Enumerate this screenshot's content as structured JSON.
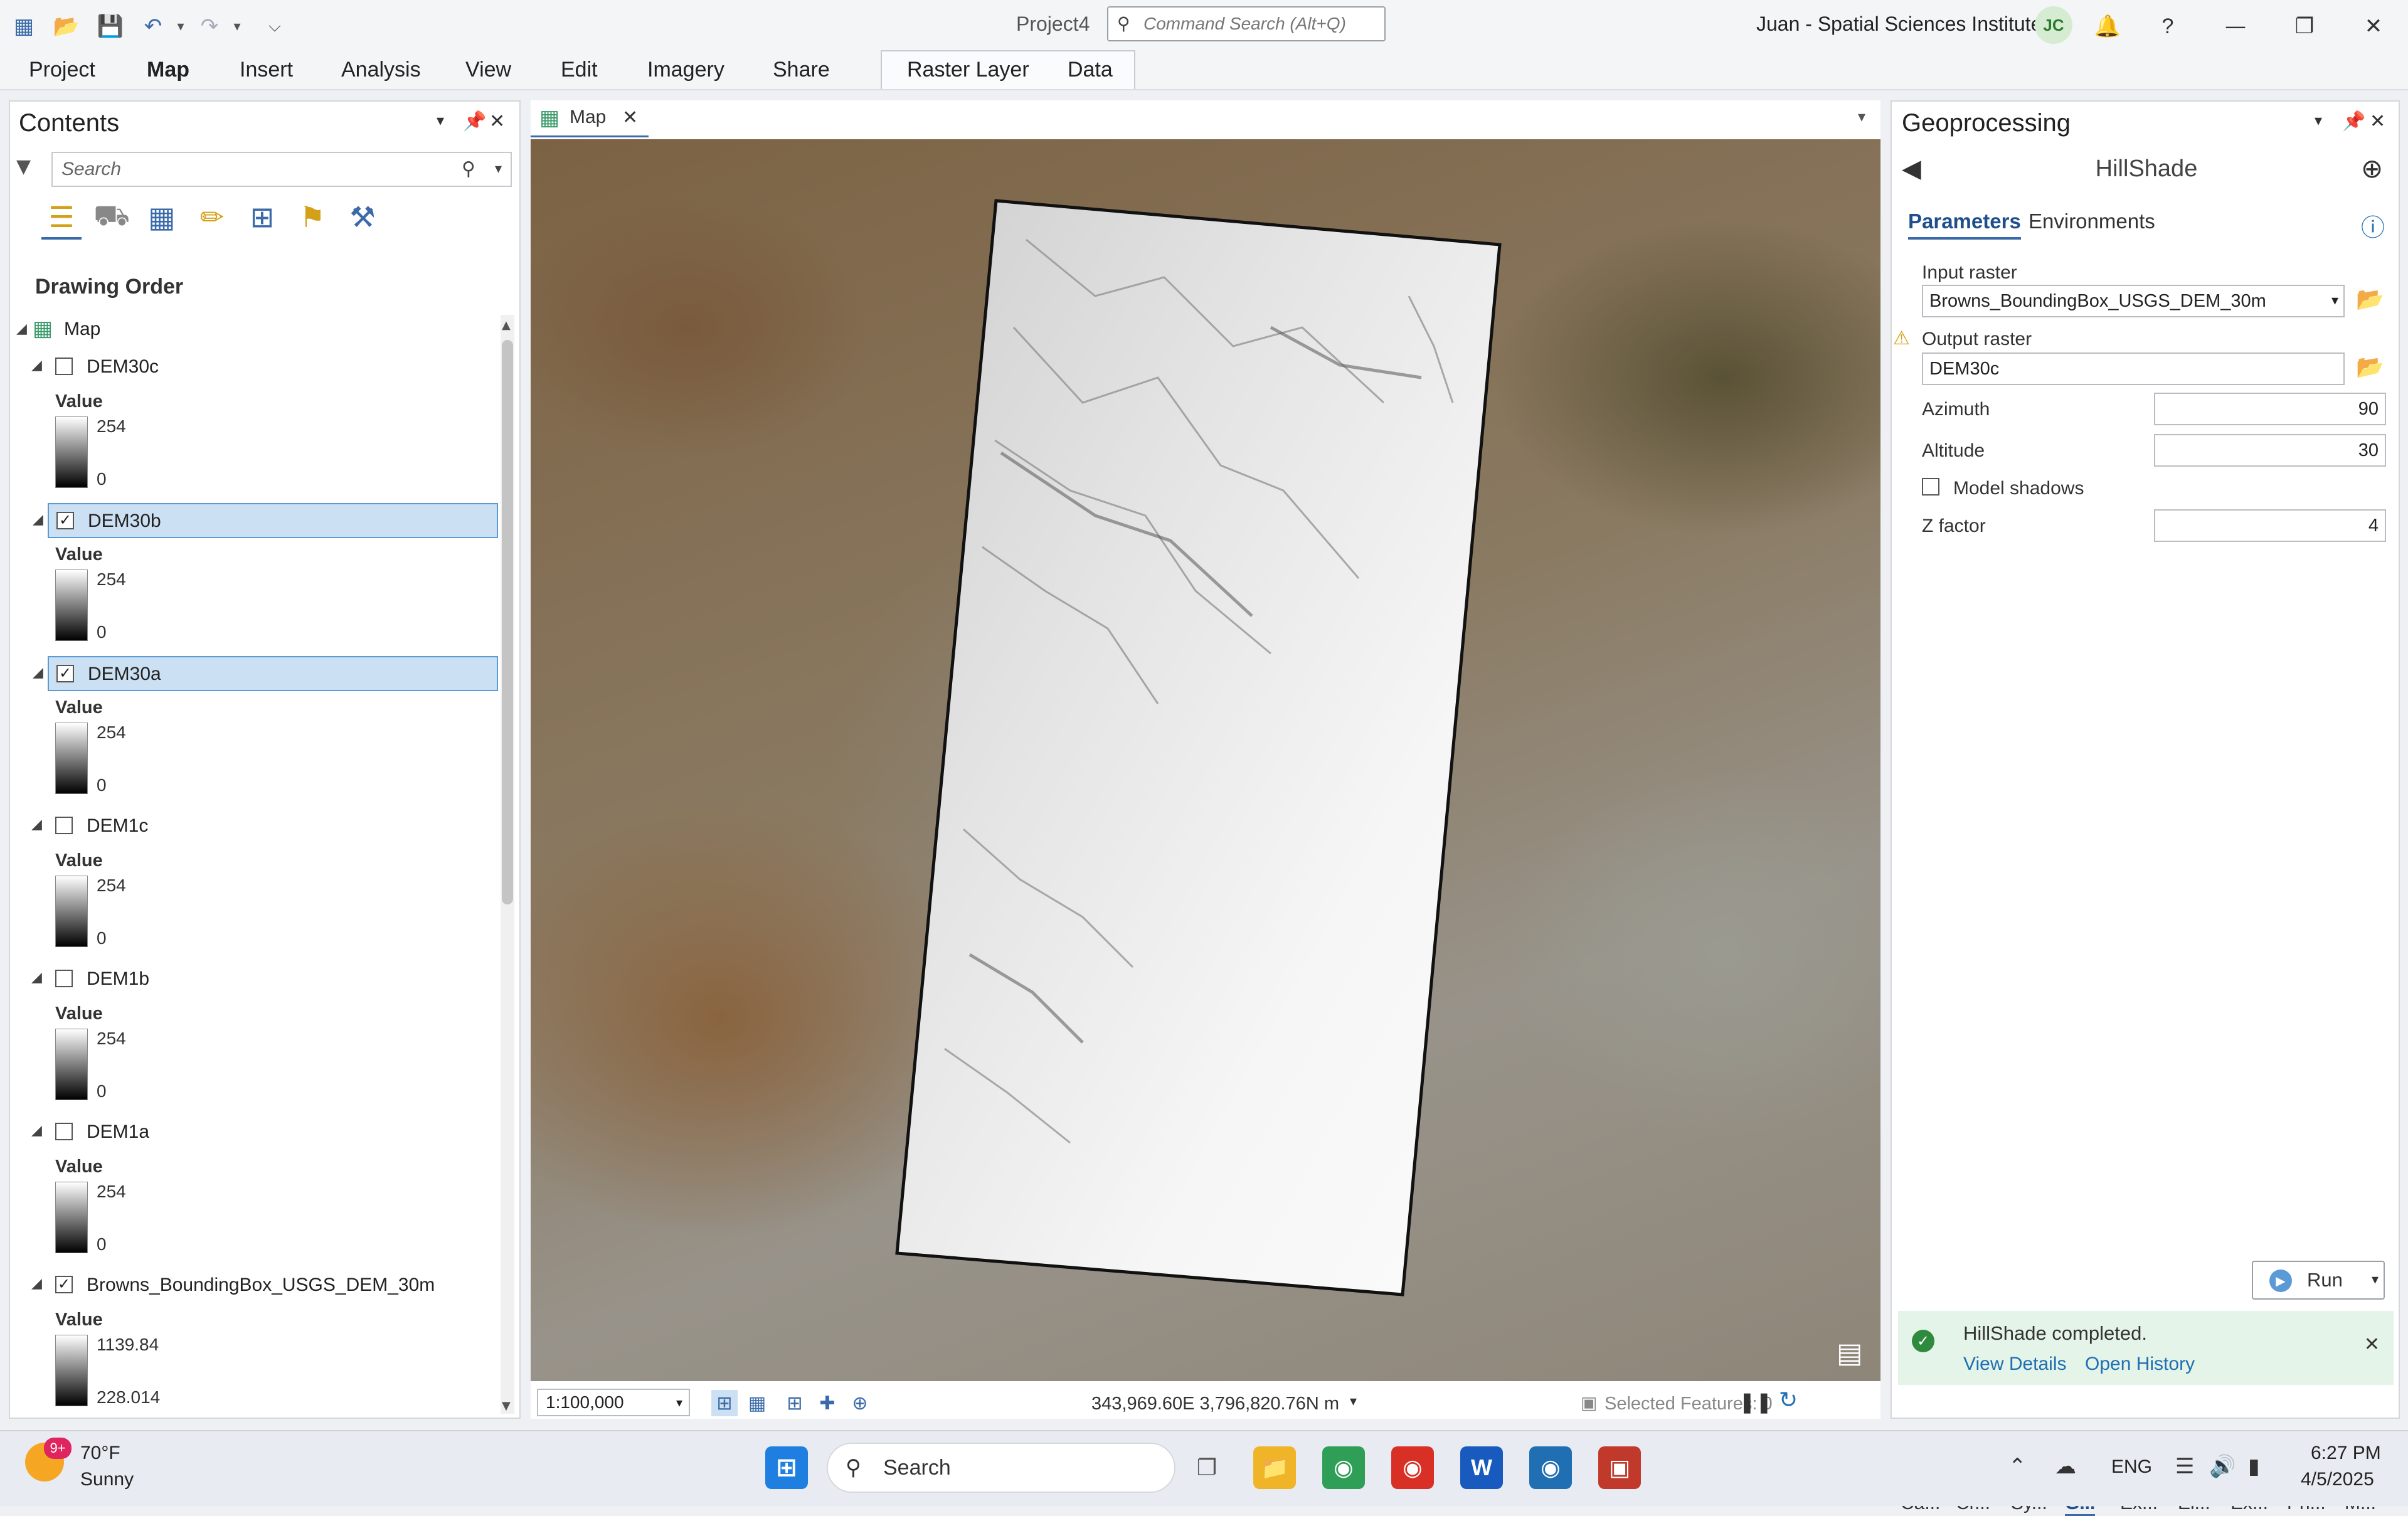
{
  "title_bar": {
    "app_title": "Project4",
    "command_search_placeholder": "Command Search (Alt+Q)",
    "user": "Juan - Spatial Sciences Institute",
    "avatar_initials": "JC"
  },
  "ribbon": {
    "tabs": [
      "Project",
      "Map",
      "Insert",
      "Analysis",
      "View",
      "Edit",
      "Imagery",
      "Share"
    ],
    "active_tab": "Map",
    "contextual_tabs": [
      "Raster Layer",
      "Data"
    ]
  },
  "contents": {
    "title": "Contents",
    "search_placeholder": "Search",
    "drawing_order_label": "Drawing Order",
    "map_label": "Map",
    "layers": [
      {
        "name": "DEM30c",
        "checked": false,
        "selected": false,
        "value_label": "Value",
        "max": "254",
        "min": "0"
      },
      {
        "name": "DEM30b",
        "checked": true,
        "selected": true,
        "value_label": "Value",
        "max": "254",
        "min": "0"
      },
      {
        "name": "DEM30a",
        "checked": true,
        "selected": true,
        "value_label": "Value",
        "max": "254",
        "min": "0"
      },
      {
        "name": "DEM1c",
        "checked": false,
        "selected": false,
        "value_label": "Value",
        "max": "254",
        "min": "0"
      },
      {
        "name": "DEM1b",
        "checked": false,
        "selected": false,
        "value_label": "Value",
        "max": "254",
        "min": "0"
      },
      {
        "name": "DEM1a",
        "checked": false,
        "selected": false,
        "value_label": "Value",
        "max": "254",
        "min": "0"
      },
      {
        "name": "Browns_BoundingBox_USGS_DEM_30m",
        "checked": true,
        "selected": false,
        "value_label": "Value",
        "max": "1139.84",
        "min": "228.014"
      }
    ]
  },
  "map_view": {
    "tab_label": "Map",
    "scale": "1:100,000",
    "coordinates": "343,969.60E 3,796,820.76N m",
    "selected_features": "Selected Features: 0"
  },
  "geoprocessing": {
    "title": "Geoprocessing",
    "tool_name": "HillShade",
    "tabs": [
      "Parameters",
      "Environments"
    ],
    "active_tab": "Parameters",
    "input_raster_label": "Input raster",
    "input_raster_value": "Browns_BoundingBox_USGS_DEM_30m",
    "output_raster_label": "Output raster",
    "output_raster_value": "DEM30c",
    "azimuth_label": "Azimuth",
    "azimuth_value": "90",
    "altitude_label": "Altitude",
    "altitude_value": "30",
    "model_shadows_label": "Model shadows",
    "model_shadows_checked": false,
    "z_factor_label": "Z factor",
    "z_factor_value": "4",
    "run_label": "Run",
    "message": "HillShade completed.",
    "view_details": "View Details",
    "open_history": "Open History",
    "bottom_tabs": [
      "Ca...",
      "Cr...",
      "Sy...",
      "G...",
      "Ex...",
      "El...",
      "Ex...",
      "Pri...",
      "M..."
    ],
    "active_bottom_tab": "G..."
  },
  "taskbar": {
    "weather_badge": "9+",
    "temperature": "70°F",
    "condition": "Sunny",
    "search_label": "Search",
    "word_letter": "W",
    "language": "ENG",
    "time": "6:27 PM",
    "date": "4/5/2025"
  },
  "colors": {
    "accent": "#3a6aa8",
    "selection": "#cce0f3",
    "success_bg": "#e5f4e8",
    "success": "#2e8b3e"
  }
}
